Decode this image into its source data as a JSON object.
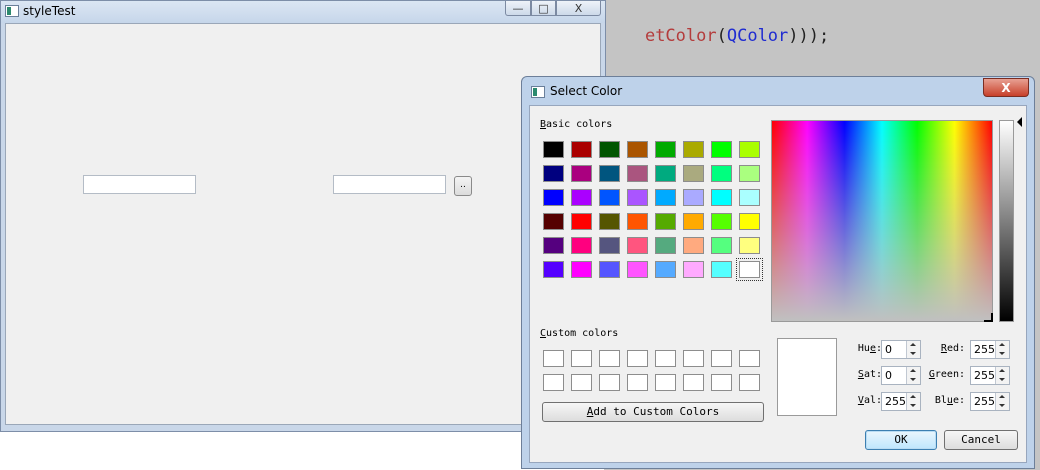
{
  "code_bg": {
    "line_parts": [
      {
        "text": "etColor",
        "class": "c-red"
      },
      {
        "text": "(",
        "class": "c-dark"
      },
      {
        "text": "QColor",
        "class": "c-blue"
      },
      {
        "text": ")));",
        "class": "c-dark"
      }
    ]
  },
  "main_window": {
    "title": "styleTest",
    "browse_label": "..",
    "caption_buttons": {
      "minimize": "—",
      "maximize": "□",
      "close": "X"
    }
  },
  "dialog": {
    "title": "Select Color",
    "close_label": "X",
    "basic_colors_label": [
      "B",
      "asic colors"
    ],
    "custom_colors_label": [
      "C",
      "ustom colors"
    ],
    "add_custom_label": [
      "A",
      "dd to Custom Colors"
    ],
    "basic_colors": [
      [
        "#000000",
        "#aa0000",
        "#005500",
        "#aa5500",
        "#00aa00",
        "#aaaa00",
        "#00ff00",
        "#aaff00"
      ],
      [
        "#00007f",
        "#aa007f",
        "#00557f",
        "#aa557f",
        "#00aa7f",
        "#aaaa7f",
        "#00ff7f",
        "#aaff7f"
      ],
      [
        "#0000ff",
        "#aa00ff",
        "#0055ff",
        "#aa55ff",
        "#00aaff",
        "#aaaaff",
        "#00ffff",
        "#aaffff"
      ],
      [
        "#550000",
        "#ff0000",
        "#555500",
        "#ff5500",
        "#55aa00",
        "#ffaa00",
        "#55ff00",
        "#ffff00"
      ],
      [
        "#55007f",
        "#ff007f",
        "#55557f",
        "#ff557f",
        "#55aa7f",
        "#ffaa7f",
        "#55ff7f",
        "#ffff7f"
      ],
      [
        "#5500ff",
        "#ff00ff",
        "#5555ff",
        "#ff55ff",
        "#55aaff",
        "#ffaaff",
        "#55ffff",
        "#ffffff"
      ]
    ],
    "selected_color": "#ffffff",
    "fields": {
      "hue": {
        "label": [
          "Hu",
          "e",
          ":"
        ],
        "value": "0"
      },
      "sat": {
        "label": [
          "",
          "S",
          "at:"
        ],
        "value": "0"
      },
      "val": {
        "label": [
          "",
          "V",
          "al:"
        ],
        "value": "255"
      },
      "red": {
        "label": [
          "",
          "R",
          "ed:"
        ],
        "value": "255"
      },
      "green": {
        "label": [
          "",
          "G",
          "reen:"
        ],
        "value": "255"
      },
      "blue": {
        "label": [
          "Bl",
          "u",
          "e:"
        ],
        "value": "255"
      }
    },
    "ok_label": "OK",
    "cancel_label": "Cancel"
  }
}
